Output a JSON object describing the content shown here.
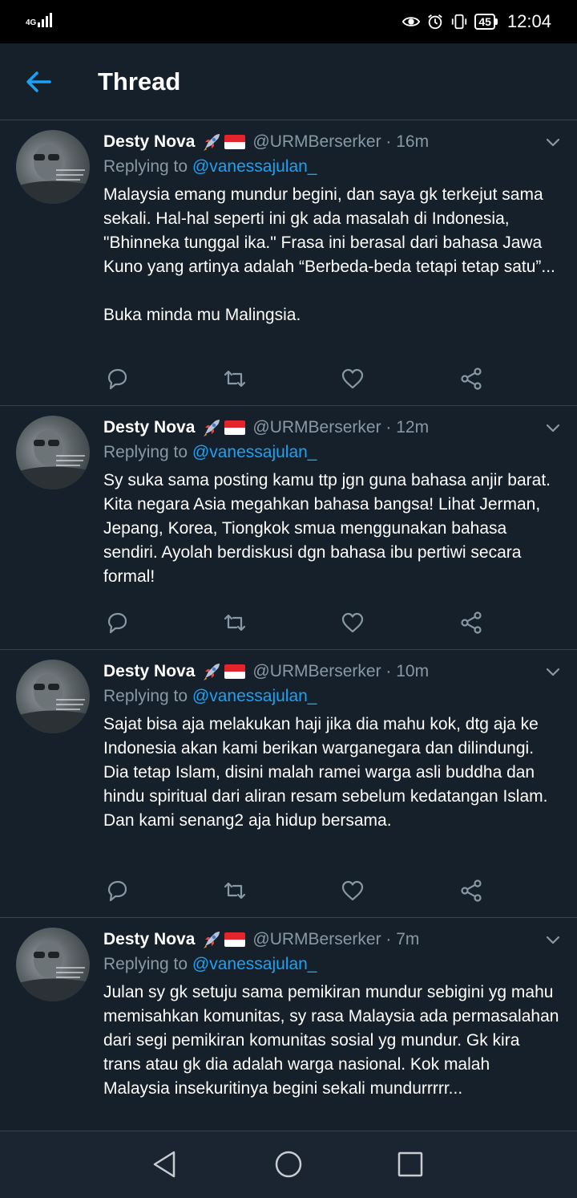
{
  "status_bar": {
    "network": "4G",
    "battery": "45",
    "time": "12:04"
  },
  "header": {
    "title": "Thread"
  },
  "tweets": [
    {
      "name": "Desty Nova",
      "handle": "@URMBerserker · 16m",
      "replying_prefix": "Replying to ",
      "replying_to": "@vanessajulan_",
      "text": "Malaysia emang mundur begini, dan saya gk terkejut sama sekali. Hal-hal seperti ini gk ada masalah di Indonesia, \"Bhinneka tunggal ika.\" Frasa ini berasal dari bahasa Jawa Kuno yang artinya adalah “Berbeda-beda tetapi tetap satu”...\n\nBuka minda mu Malingsia."
    },
    {
      "name": "Desty Nova",
      "handle": "@URMBerserker · 12m",
      "replying_prefix": "Replying to ",
      "replying_to": "@vanessajulan_",
      "text": "Sy suka sama posting kamu ttp jgn guna bahasa anjir barat. Kita negara Asia megahkan bahasa bangsa! Lihat Jerman, Jepang, Korea, Tiongkok smua menggunakan bahasa sendiri. Ayolah berdiskusi dgn bahasa ibu pertiwi secara formal!"
    },
    {
      "name": "Desty Nova",
      "handle": "@URMBerserker · 10m",
      "replying_prefix": "Replying to ",
      "replying_to": "@vanessajulan_",
      "text": "Sajat bisa aja melakukan haji jika dia mahu kok, dtg aja ke Indonesia akan kami berikan warganegara dan dilindungi. Dia tetap Islam, disini malah ramei warga asli buddha dan hindu spiritual dari aliran resam sebelum kedatangan Islam. Dan kami senang2 aja hidup bersama."
    },
    {
      "name": "Desty Nova",
      "handle": "@URMBerserker · 7m",
      "replying_prefix": "Replying to ",
      "replying_to": "@vanessajulan_",
      "text": "Julan sy gk setuju sama pemikiran mundur sebigini yg mahu memisahkan komunitas, sy rasa Malaysia ada permasalahan dari segi pemikiran komunitas sosial yg mundur. Gk kira trans atau gk dia adalah warga nasional. Kok malah Malaysia insekuritinya begini sekali mundurrrrr..."
    }
  ],
  "icons": {
    "reply": "speech-bubble-icon",
    "retweet": "retweet-icon",
    "like": "heart-icon",
    "share": "share-icon",
    "rocket": "rocket-emoji",
    "flag": "indonesia-flag-emoji"
  },
  "colors": {
    "background": "#15202b",
    "accent": "#1da1f2",
    "muted": "#8899a6",
    "divider": "#38444d"
  }
}
